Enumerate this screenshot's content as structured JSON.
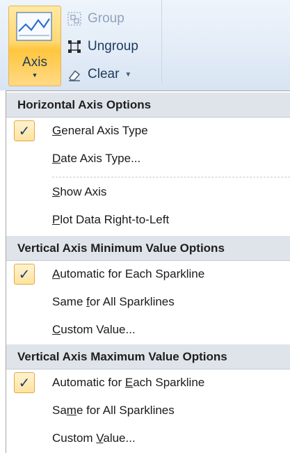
{
  "ribbon": {
    "axis_button_label": "Axis",
    "group_label": "Group",
    "ungroup_label": "Ungroup",
    "clear_label": "Clear"
  },
  "menu": {
    "horizontal_header": "Horizontal Axis Options",
    "vertical_min_header": "Vertical Axis Minimum Value Options",
    "vertical_max_header": "Vertical Axis Maximum Value Options",
    "items": [
      {
        "text": "General Axis Type",
        "checked": true
      },
      {
        "text": "Date Axis Type...",
        "checked": false
      },
      {
        "text": "Show Axis",
        "checked": false
      },
      {
        "text": "Plot Data Right-to-Left",
        "checked": false
      },
      {
        "text": "Automatic for Each Sparkline",
        "checked": true
      },
      {
        "text": "Same for All Sparklines",
        "checked": false
      },
      {
        "text": "Custom Value...",
        "checked": false
      },
      {
        "text": "Automatic for Each Sparkline",
        "checked": true
      },
      {
        "text": "Same for All Sparklines",
        "checked": false
      },
      {
        "text": "Custom Value...",
        "checked": false
      }
    ]
  },
  "colors": {
    "accent_orange": "#ffc63e",
    "checkbox_border": "#e3a64a",
    "header_bg": "#dfe4ea",
    "ribbon_text": "#1e395b"
  },
  "icons": {
    "axis": "line-chart-icon",
    "group": "group-icon",
    "ungroup": "ungroup-icon",
    "clear": "eraser-icon",
    "check": "checkmark-icon"
  }
}
